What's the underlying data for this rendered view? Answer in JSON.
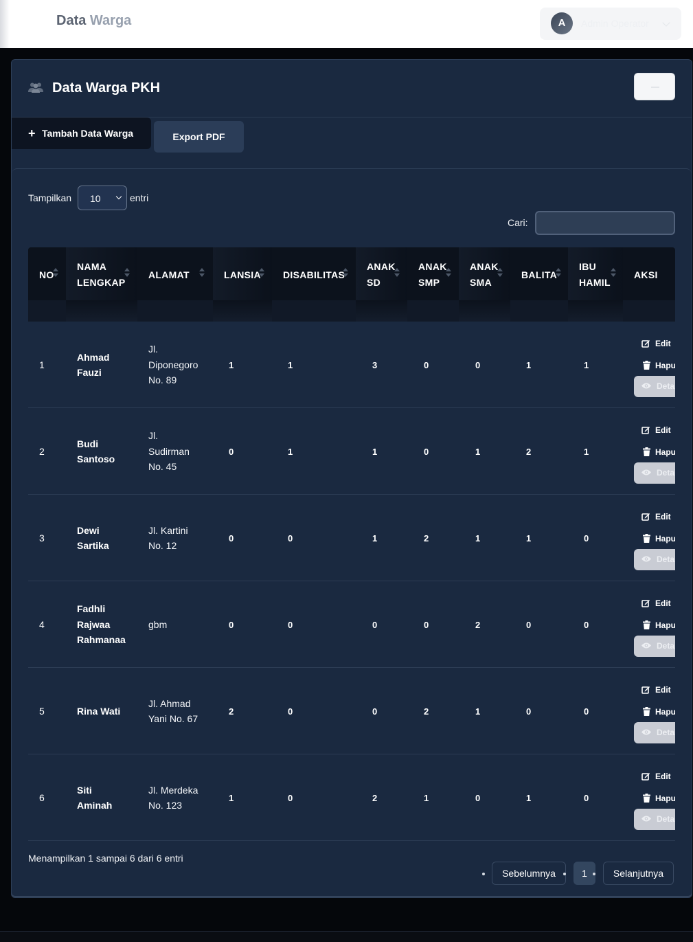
{
  "topbar": {
    "brand_part1": "Data ",
    "brand_part2": "Warga",
    "user_initial": "A",
    "user_name": "Admin Operator"
  },
  "card": {
    "title": "Data Warga PKH",
    "title_icon": "users-icon",
    "add_button": "Tambah Data Warga",
    "export_button": "Export PDF"
  },
  "table_controls": {
    "length_prefix": "Tampilkan",
    "length_value": "10",
    "length_suffix": "entri",
    "search_label": "Cari:",
    "search_value": ""
  },
  "columns": [
    "NO",
    "NAMA LENGKAP",
    "ALAMAT",
    "LANSIA",
    "DISABILITAS",
    "ANAK SD",
    "ANAK SMP",
    "ANAK SMA",
    "BALITA",
    "IBU HAMIL",
    "AKSI"
  ],
  "columns_display": {
    "no": "NO",
    "nama_1": "NAMA",
    "nama_2": "LENGKAP",
    "alamat": "ALAMAT",
    "lansia": "LANSIA",
    "disabilitas": "DISABILITAS",
    "sd_1": "ANAK",
    "sd_2": "SD",
    "smp_1": "ANAK",
    "smp_2": "SMP",
    "sma_1": "ANAK",
    "sma_2": "SMA",
    "balita": "BALITA",
    "hamil_1": "IBU",
    "hamil_2": "HAMIL",
    "aksi": "AKSI"
  },
  "actions": {
    "edit": "Edit",
    "delete": "Hapus",
    "detail": "Detail"
  },
  "rows": [
    {
      "no": "1",
      "name_lines": [
        "Ahmad",
        "Fauzi"
      ],
      "addr_lines": [
        "Jl.",
        "Diponegoro",
        "No. 89"
      ],
      "lansia": "1",
      "disabilitas": "1",
      "sd": "3",
      "smp": "0",
      "sma": "0",
      "balita": "1",
      "hamil": "1"
    },
    {
      "no": "2",
      "name_lines": [
        "Budi",
        "Santoso"
      ],
      "addr_lines": [
        "Jl.",
        "Sudirman",
        "No. 45"
      ],
      "lansia": "0",
      "disabilitas": "1",
      "sd": "1",
      "smp": "0",
      "sma": "1",
      "balita": "2",
      "hamil": "1"
    },
    {
      "no": "3",
      "name_lines": [
        "Dewi",
        "Sartika"
      ],
      "addr_lines": [
        "Jl. Kartini",
        "No. 12"
      ],
      "lansia": "0",
      "disabilitas": "0",
      "sd": "1",
      "smp": "2",
      "sma": "1",
      "balita": "1",
      "hamil": "0"
    },
    {
      "no": "4",
      "name_lines": [
        "Fadhli",
        "Rajwaa",
        "Rahmanaa"
      ],
      "addr_lines": [
        "gbm"
      ],
      "lansia": "0",
      "disabilitas": "0",
      "sd": "0",
      "smp": "0",
      "sma": "2",
      "balita": "0",
      "hamil": "0"
    },
    {
      "no": "5",
      "name_lines": [
        "Rina Wati"
      ],
      "addr_lines": [
        "Jl. Ahmad",
        "Yani No. 67"
      ],
      "lansia": "2",
      "disabilitas": "0",
      "sd": "0",
      "smp": "2",
      "sma": "1",
      "balita": "0",
      "hamil": "0"
    },
    {
      "no": "6",
      "name_lines": [
        "Siti",
        "Aminah"
      ],
      "addr_lines": [
        "Jl. Merdeka",
        "No. 123"
      ],
      "lansia": "1",
      "disabilitas": "0",
      "sd": "2",
      "smp": "1",
      "sma": "0",
      "balita": "1",
      "hamil": "0"
    }
  ],
  "footer": {
    "info": "Menampilkan 1 sampai 6 dari 6 entri",
    "prev": "Sebelumnya",
    "current_page": "1",
    "next": "Selanjutnya"
  },
  "colors": {
    "page_bg": "#05070b",
    "card_bg": "#1a2940",
    "header_bg": "#0c121c",
    "topbar_bg": "#ffffff",
    "detail_button": "#c9ccd4"
  }
}
